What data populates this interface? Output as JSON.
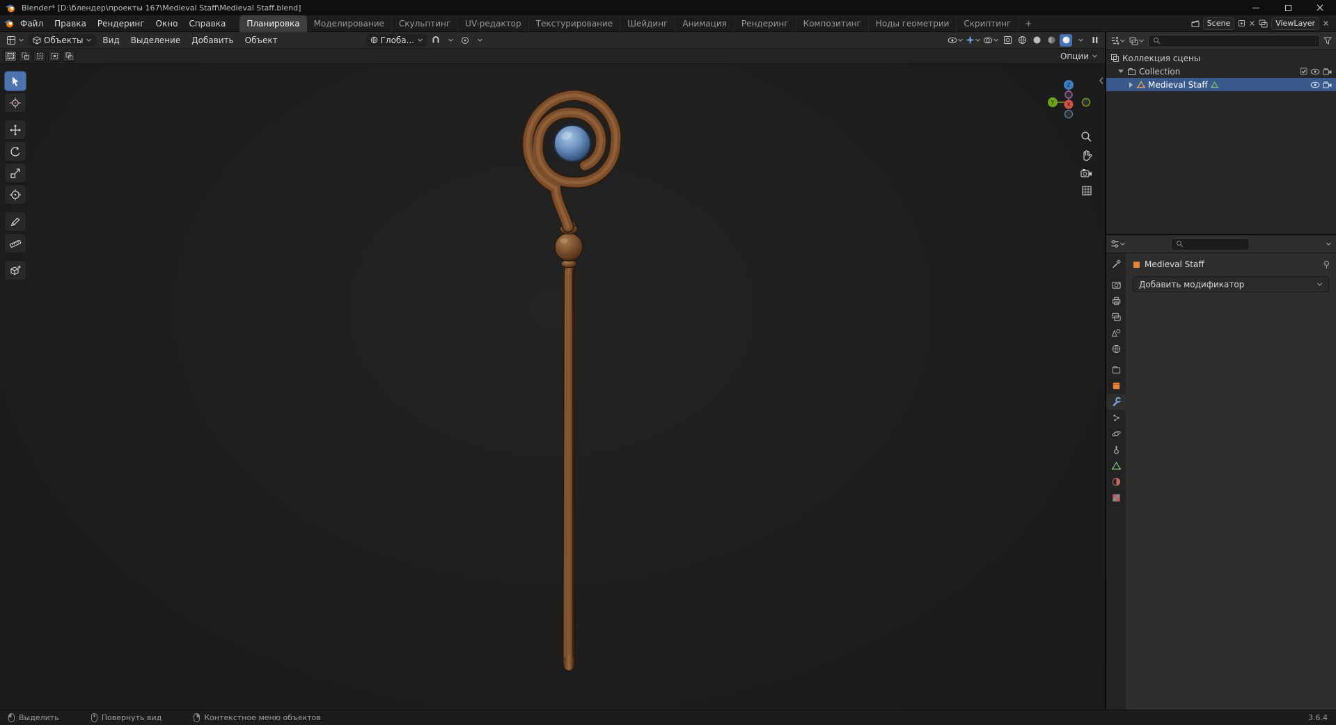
{
  "colors": {
    "accent_blue": "#4772b3",
    "object_orange": "#e8833a",
    "mesh_green": "#7ec77e",
    "selection_row_blue": "#3a5a8c",
    "axis_x_red": "#d4554a",
    "axis_y_green": "#6fa21c",
    "axis_z_blue": "#3f7fbf",
    "orb_blue": "#6e93c0",
    "staff_brown": "#7a4e2c"
  },
  "window": {
    "title": "Blender* [D:\\блендер\\проекты 167\\Medieval Staff\\Medieval Staff.blend]"
  },
  "topbar": {
    "menus": [
      "Файл",
      "Правка",
      "Рендеринг",
      "Окно",
      "Справка"
    ],
    "workspaces": [
      "Планировка",
      "Моделирование",
      "Скульптинг",
      "UV-редактор",
      "Текстурирование",
      "Шейдинг",
      "Анимация",
      "Рендеринг",
      "Композитинг",
      "Ноды геометрии",
      "Скриптинг"
    ],
    "active_workspace_index": 0,
    "add_workspace_label": "+",
    "scene_label": "Scene",
    "view_layer_label": "ViewLayer"
  },
  "viewport": {
    "mode_label": "Объекты",
    "menus": [
      "Вид",
      "Выделение",
      "Добавить",
      "Объект"
    ],
    "orientation_label": "Глоба...",
    "options_label": "Опции",
    "axis_labels": {
      "x": "X",
      "y": "Y",
      "z": "Z"
    }
  },
  "outliner": {
    "rows": [
      {
        "label": "Коллекция сцены"
      },
      {
        "label": "Collection"
      },
      {
        "label": "Medieval Staff"
      }
    ],
    "selected_row": "Medieval Staff"
  },
  "properties": {
    "object_name": "Medieval Staff",
    "add_modifier_label": "Добавить модификатор",
    "active_tab": "modifiers"
  },
  "statusbar": {
    "items": [
      "Выделить",
      "Повернуть вид",
      "Контекстное меню объектов"
    ],
    "version": "3.6.4"
  }
}
